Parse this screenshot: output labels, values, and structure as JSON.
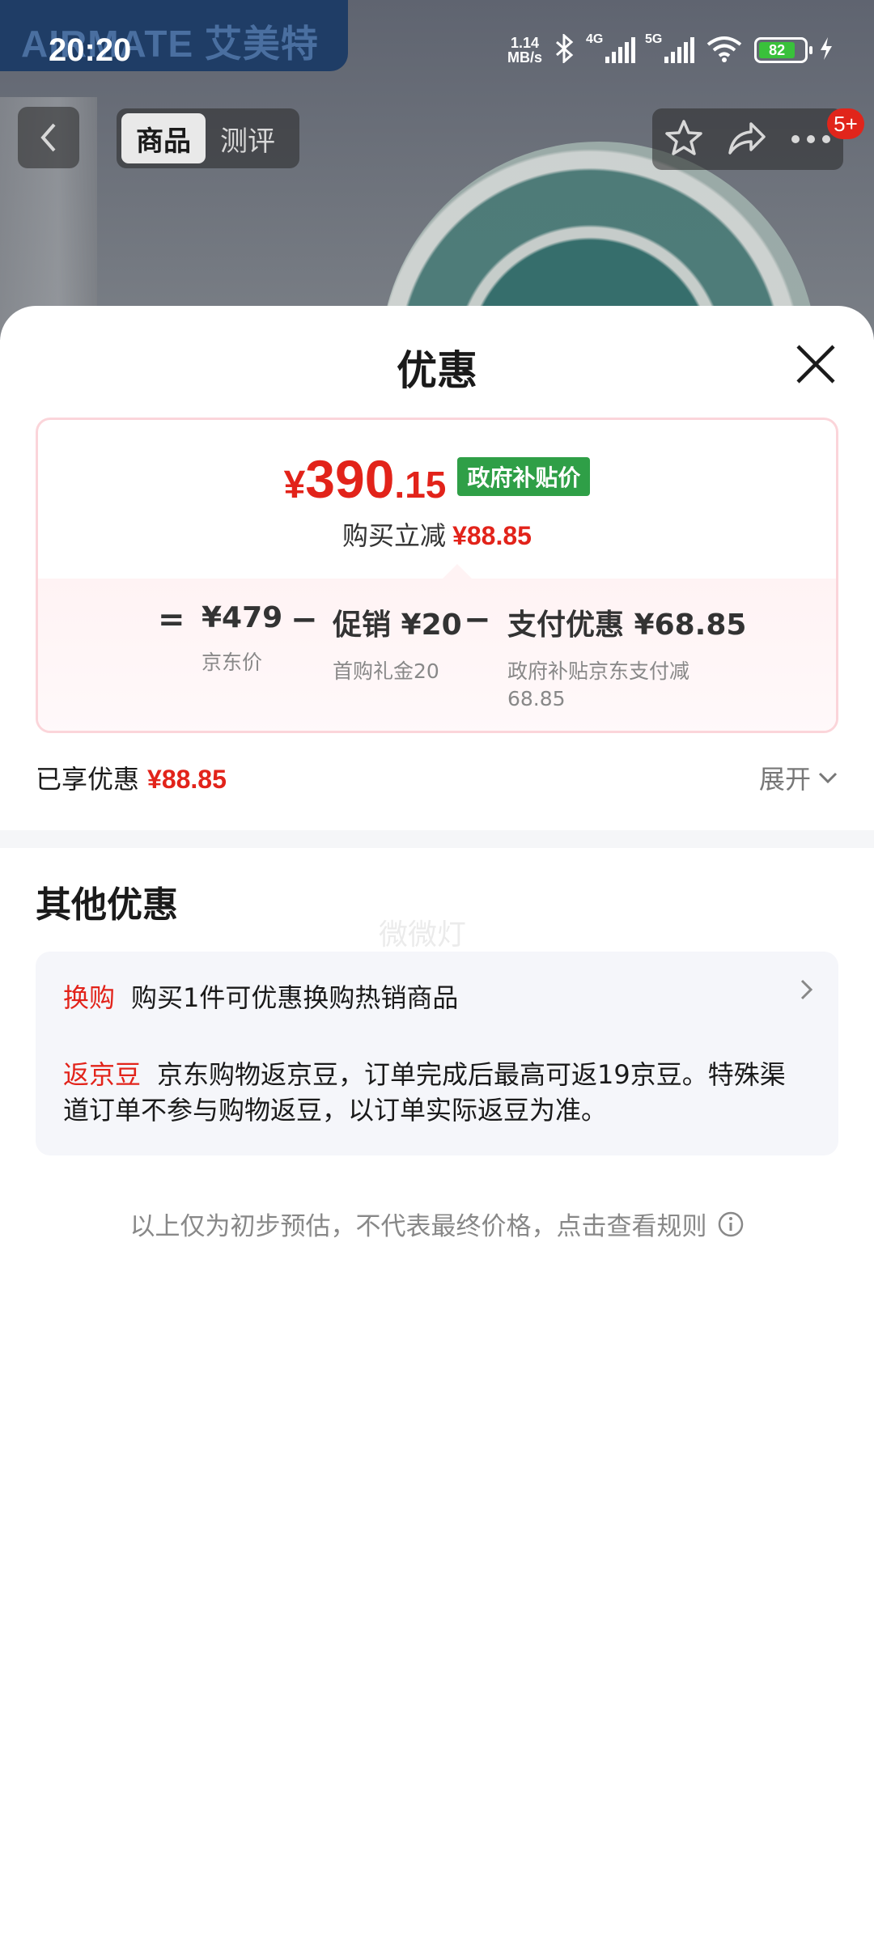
{
  "status_bar": {
    "time": "20:20",
    "net_speed_value": "1.14",
    "net_speed_unit": "MB/s",
    "signal1_tag": "4G",
    "signal2_tag": "5G",
    "battery": "82"
  },
  "background": {
    "brand_logo": "AIRMATE 艾美特"
  },
  "top_nav": {
    "tabs": [
      {
        "label": "商品",
        "active": true
      },
      {
        "label": "测评",
        "active": false
      }
    ],
    "badge": "5+"
  },
  "sheet": {
    "title": "优惠",
    "price": {
      "currency": "¥",
      "integer": "390",
      "decimal": ".15",
      "tag": "政府补贴价",
      "save_label": "购买立减",
      "save_amount": "¥88.85"
    },
    "formula": {
      "equals": "=",
      "minus": "−",
      "items": [
        {
          "value": "¥479",
          "label": "京东价"
        },
        {
          "value": "促销 ¥20",
          "label": "首购礼金20"
        },
        {
          "value": "支付优惠 ¥68.85",
          "label": "政府补贴京东支付减",
          "label2": "68.85"
        }
      ]
    },
    "enjoyed_label": "已享优惠",
    "enjoyed_amount": "¥88.85",
    "expand_label": "展开",
    "other_title": "其他优惠",
    "watermark": "微微灯",
    "other_items": [
      {
        "tag": "换购",
        "text": "购买1件可优惠换购热销商品"
      },
      {
        "tag": "返京豆",
        "text": "京东购物返京豆，订单完成后最高可返19京豆。特殊渠道订单不参与购物返豆，以订单实际返豆为准。"
      }
    ],
    "footnote": "以上仅为初步预估，不代表最终价格，点击查看规则"
  },
  "colors": {
    "accent_red": "#e2231a",
    "gov_green": "#2f9f47",
    "card_border": "#fbd5da"
  }
}
